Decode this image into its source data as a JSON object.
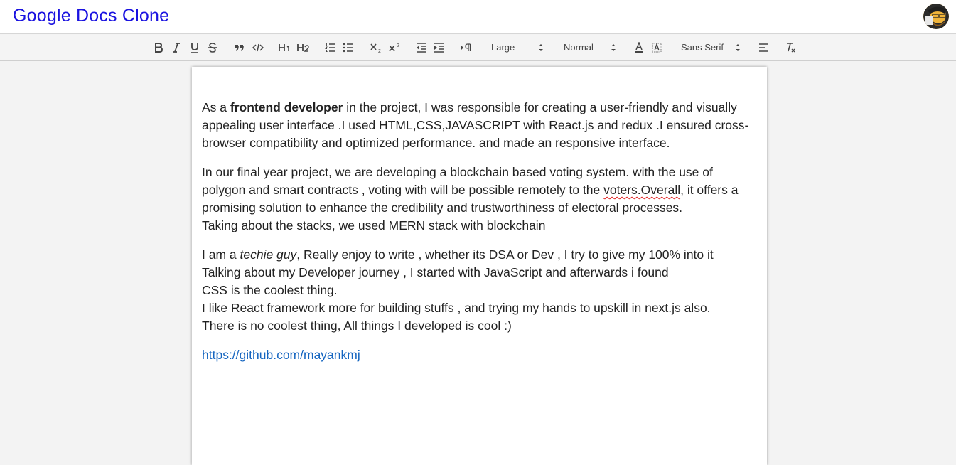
{
  "header": {
    "app_title": "Google Docs Clone",
    "avatar_icon": "user-avatar"
  },
  "toolbar": {
    "buttons": [
      {
        "name": "bold",
        "icon": "bold-icon"
      },
      {
        "name": "italic",
        "icon": "italic-icon"
      },
      {
        "name": "underline",
        "icon": "underline-icon"
      },
      {
        "name": "strike",
        "icon": "strikethrough-icon"
      },
      {
        "name": "blockquote",
        "icon": "quote-icon"
      },
      {
        "name": "code-block",
        "icon": "code-icon"
      },
      {
        "name": "header-1",
        "icon": "h1-icon"
      },
      {
        "name": "header-2",
        "icon": "h2-icon"
      },
      {
        "name": "ordered-list",
        "icon": "ordered-list-icon"
      },
      {
        "name": "bullet-list",
        "icon": "bullet-list-icon"
      },
      {
        "name": "subscript",
        "icon": "subscript-icon"
      },
      {
        "name": "superscript",
        "icon": "superscript-icon"
      },
      {
        "name": "outdent",
        "icon": "outdent-icon"
      },
      {
        "name": "indent",
        "icon": "indent-icon"
      },
      {
        "name": "text-direction",
        "icon": "rtl-icon"
      },
      {
        "name": "font-color",
        "icon": "font-color-icon"
      },
      {
        "name": "background-color",
        "icon": "highlight-icon"
      },
      {
        "name": "align",
        "icon": "align-left-icon"
      },
      {
        "name": "clean",
        "icon": "clear-format-icon"
      }
    ],
    "size_select": "Large",
    "header_select": "Normal",
    "font_select": "Sans Serif"
  },
  "document": {
    "p1": {
      "before": "As a ",
      "bold": "frontend developer",
      "after": " in the project, I was responsible for creating a user-friendly and visually appealing user interface .I used HTML,CSS,JAVASCRIPT with React.js and redux .I ensured cross-browser compatibility and optimized performance. and made an responsive interface."
    },
    "p2": {
      "before": "In our final year project, we are developing a blockchain based voting system. with the use of polygon and smart contracts , voting with will be possible remotely to the ",
      "misspelled": "voters.Overall",
      "after": ", it offers a promising solution to enhance the credibility and trustworthiness of electoral processes.",
      "line2": "Taking about the stacks, we used MERN stack with blockchain"
    },
    "p3": {
      "before": "I am a ",
      "italic": "techie guy",
      "after": ", Really enjoy to write , whether its DSA or Dev , I try to give my 100% into it",
      "line2": "Talking about my Developer journey , I started with JavaScript and afterwards i found",
      "line3": "CSS is the coolest thing.",
      "line4": "I like React framework more for building stuffs , and trying my hands to upskill in next.js also.",
      "line5": "There is no coolest thing, All things I developed is cool :)"
    },
    "link": "https://github.com/mayankmj"
  },
  "colors": {
    "title": "#1a12e0",
    "link": "#1565c0",
    "spellcheck": "#e02020"
  }
}
